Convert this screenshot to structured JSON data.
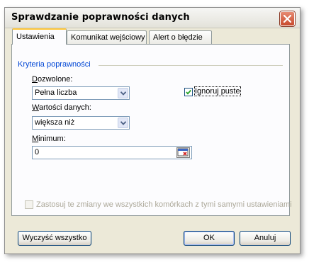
{
  "dialog": {
    "title": "Sprawdzanie poprawności danych"
  },
  "tabs": [
    {
      "label": "Ustawienia",
      "active": true
    },
    {
      "label": "Komunikat wejściowy",
      "active": false
    },
    {
      "label": "Alert o błędzie",
      "active": false
    }
  ],
  "criteria": {
    "group_label": "Kryteria poprawności",
    "allow_label": "Dozwolone:",
    "allow_value": "Pełna liczba",
    "ignore_blank_label": "Ignoruj puste",
    "ignore_blank_checked": true,
    "data_label": "Wartości danych:",
    "data_value": "większa niż",
    "minimum_label": "Minimum:",
    "minimum_value": "0"
  },
  "apply_all": {
    "label": "Zastosuj te zmiany we wszystkich komórkach z tymi samymi ustawieniami",
    "checked": false,
    "enabled": false
  },
  "buttons": {
    "clear_all": "Wyczyść wszystko",
    "ok": "OK",
    "cancel": "Anuluj"
  },
  "colors": {
    "dialog_bg": "#ece9d8",
    "panel_bg": "#fcfcfe",
    "group_label": "#0046d5",
    "active_tab_accent": "#ffc83c",
    "close_button": "#c84a2d"
  }
}
